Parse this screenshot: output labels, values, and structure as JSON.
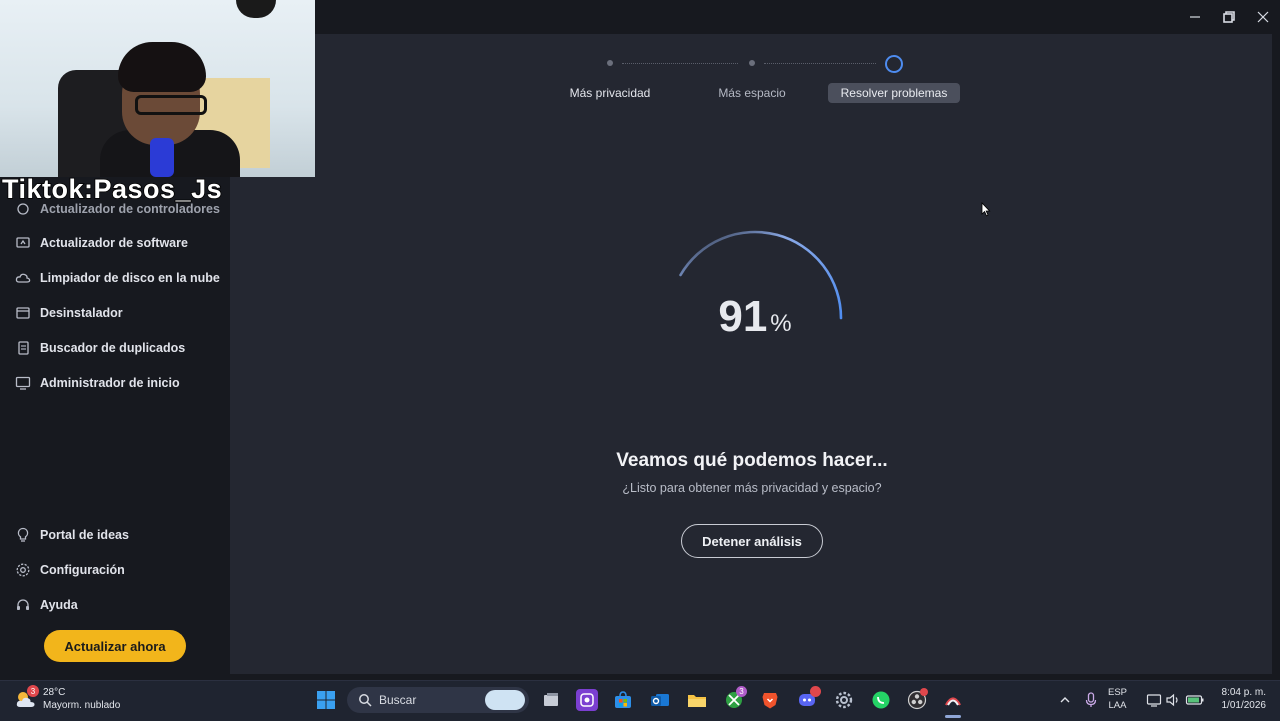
{
  "overlay": {
    "watermark": "Tiktok:Pasos_Js"
  },
  "sidebar": {
    "items": [
      {
        "label": "Actualizador de controladores",
        "icon": "driver-icon"
      },
      {
        "label": "Actualizador de software",
        "icon": "software-update-icon"
      },
      {
        "label": "Limpiador de disco en la nube",
        "icon": "cloud-disk-icon"
      },
      {
        "label": "Desinstalador",
        "icon": "uninstall-icon"
      },
      {
        "label": "Buscador de duplicados",
        "icon": "duplicate-icon"
      },
      {
        "label": "Administrador de inicio",
        "icon": "monitor-icon"
      }
    ],
    "bottom_items": [
      {
        "label": "Portal de ideas",
        "icon": "lightbulb-icon"
      },
      {
        "label": "Configuración",
        "icon": "gear-icon"
      },
      {
        "label": "Ayuda",
        "icon": "help-icon"
      }
    ],
    "upgrade_label": "Actualizar ahora"
  },
  "stepper": {
    "steps": [
      {
        "label": "Más privacidad"
      },
      {
        "label": "Más espacio"
      },
      {
        "label": "Resolver problemas"
      }
    ],
    "active_step": 3
  },
  "scan": {
    "progress": 91,
    "percent_symbol": "%",
    "headline": "Veamos qué podemos hacer...",
    "subline": "¿Listo para obtener más privacidad y espacio?",
    "stop_label": "Detener análisis"
  },
  "taskbar": {
    "weather": {
      "temp": "28°C",
      "desc": "Mayorm. nublado",
      "badge": "3"
    },
    "search_placeholder": "Buscar",
    "xbox_badge": "3",
    "language": {
      "line1": "ESP",
      "line2": "LAA"
    },
    "clock": {
      "time": "8:04 p. m.",
      "date": "1/01/2026"
    }
  },
  "colors": {
    "accent": "#4e8cf0",
    "upgrade": "#f2b51b",
    "panel": "#242731",
    "background": "#17191f"
  }
}
